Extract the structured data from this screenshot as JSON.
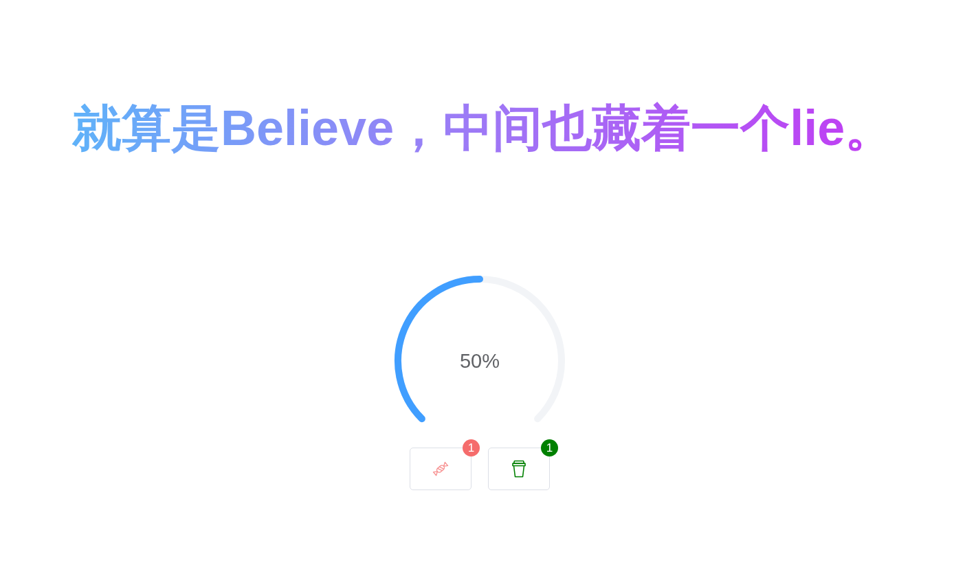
{
  "heading": "就算是Believe，中间也藏着一个lie。",
  "progress": {
    "level": 0.5,
    "label": "50%"
  },
  "buttons": [
    {
      "kind": "candy",
      "badge": "1",
      "color": "#f56c6c"
    },
    {
      "kind": "cup",
      "badge": "1",
      "color": "#008000"
    }
  ]
}
